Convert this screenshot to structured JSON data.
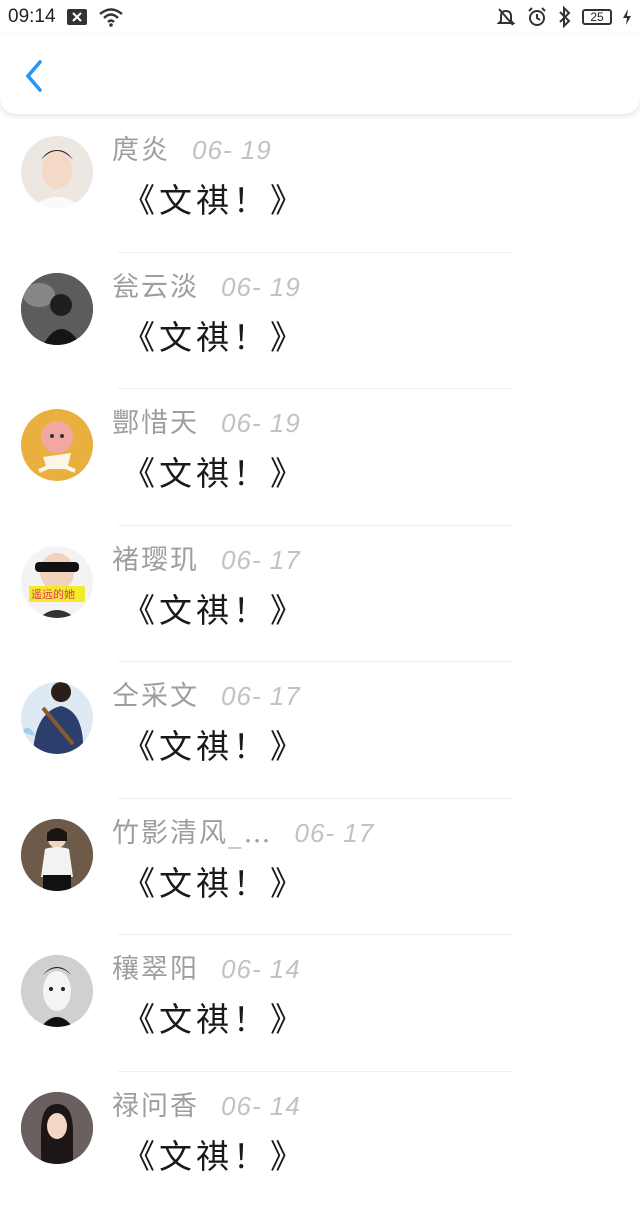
{
  "status_bar": {
    "time": "09:14",
    "battery": "25",
    "icons": [
      "close-box-icon",
      "wifi-icon",
      "bell-off-icon",
      "alarm-icon",
      "bluetooth-icon",
      "charging-icon"
    ]
  },
  "header": {
    "back_icon": "chevron-left-icon",
    "accent_color": "#2196F3"
  },
  "items": [
    {
      "name": "庹炎",
      "date": "06- 19",
      "message": "《文祺！》",
      "avatar_color": "#e8e2dc"
    },
    {
      "name": "瓮云淡",
      "date": "06- 19",
      "message": "《文祺！》",
      "avatar_color": "#4a4a4a"
    },
    {
      "name": "酆惜天",
      "date": "06- 19",
      "message": "《文祺！》",
      "avatar_color": "#e9b040"
    },
    {
      "name": "褚璎玑",
      "date": "06- 17",
      "message": "《文祺！》",
      "avatar_color": "#f0f0f0",
      "avatar_text": "遥远的她"
    },
    {
      "name": "仝采文",
      "date": "06- 17",
      "message": "《文祺！》",
      "avatar_color": "#2c3e6b"
    },
    {
      "name": "竹影清风_…",
      "date": "06- 17",
      "message": "《文祺！》",
      "avatar_color": "#6b5a4a"
    },
    {
      "name": "穰翠阳",
      "date": "06- 14",
      "message": "《文祺！》",
      "avatar_color": "#bdbdbd"
    },
    {
      "name": "禄问香",
      "date": "06- 14",
      "message": "《文祺！》",
      "avatar_color": "#5a5050"
    }
  ]
}
